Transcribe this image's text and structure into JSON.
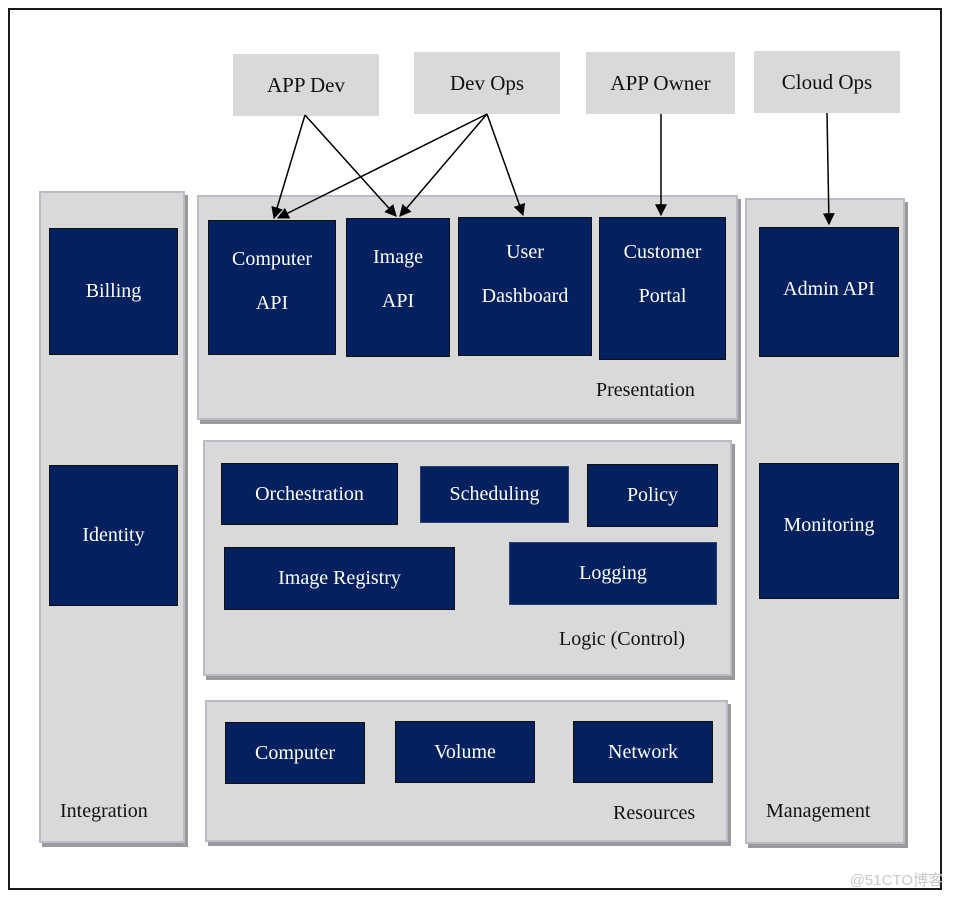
{
  "actors": {
    "app_dev": "APP Dev",
    "dev_ops": "Dev Ops",
    "app_owner": "APP Owner",
    "cloud_ops": "Cloud Ops"
  },
  "integration": {
    "label": "Integration",
    "components": [
      "Billing",
      "Identity"
    ]
  },
  "presentation": {
    "label": "Presentation",
    "components": [
      {
        "line1": "Computer",
        "line2": "API"
      },
      {
        "line1": "Image",
        "line2": "API"
      },
      {
        "line1": "User",
        "line2": "Dashboard"
      },
      {
        "line1": "Customer",
        "line2": "Portal"
      }
    ]
  },
  "logic": {
    "label": "Logic (Control)",
    "components": [
      "Orchestration",
      "Scheduling",
      "Policy",
      "Image Registry",
      "Logging"
    ]
  },
  "resources": {
    "label": "Resources",
    "components": [
      "Computer",
      "Volume",
      "Network"
    ]
  },
  "management": {
    "label": "Management",
    "components": [
      "Admin API",
      "Monitoring"
    ]
  },
  "connections": [
    {
      "from": "APP Dev",
      "to": "Computer API"
    },
    {
      "from": "APP Dev",
      "to": "Image API"
    },
    {
      "from": "Dev Ops",
      "to": "Computer API"
    },
    {
      "from": "Dev Ops",
      "to": "Image API"
    },
    {
      "from": "Dev Ops",
      "to": "User Dashboard"
    },
    {
      "from": "APP Owner",
      "to": "Customer Portal"
    },
    {
      "from": "Cloud Ops",
      "to": "Admin API"
    }
  ],
  "colors": {
    "component_fill": "#03215f",
    "panel_fill": "#d9d9d9"
  },
  "watermark": "@51CTO博客"
}
